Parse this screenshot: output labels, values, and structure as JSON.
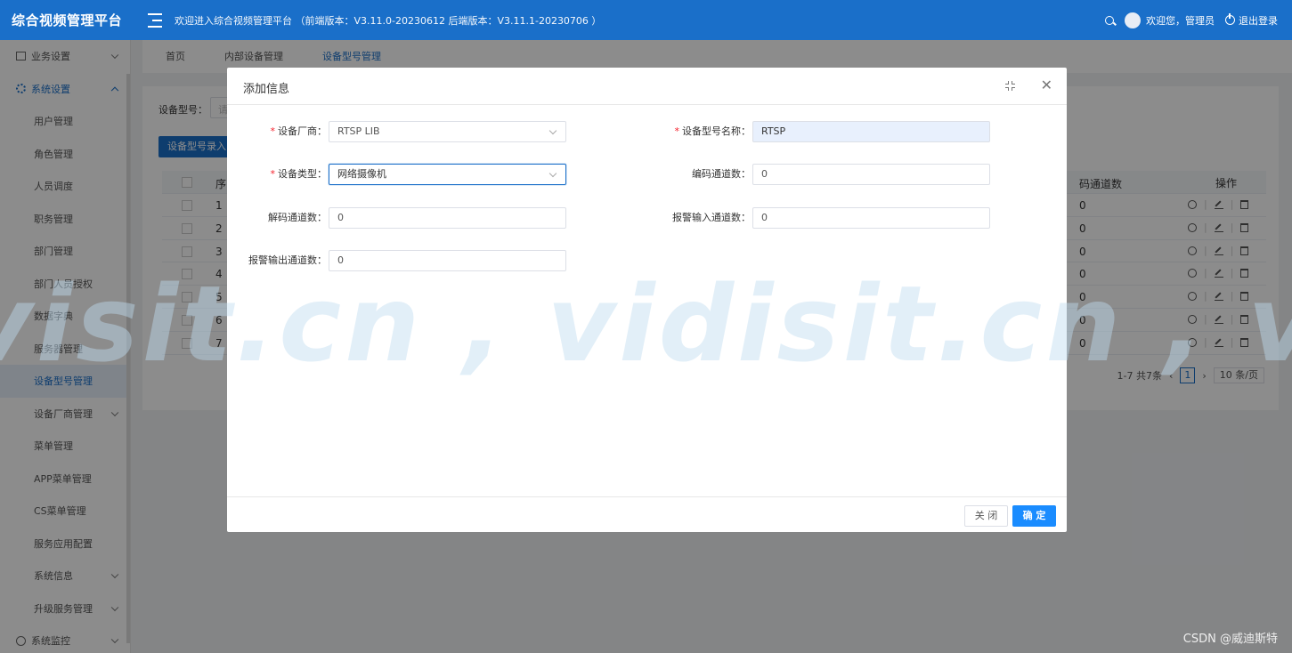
{
  "header": {
    "brand": "综合视频管理平台",
    "welcome": "欢迎进入综合视频管理平台 （前端版本：V3.11.0-20230612 后端版本：V3.11.1-20230706 ）",
    "user_greeting": "欢迎您，管理员",
    "logout": "退出登录"
  },
  "sidebar": {
    "groups": [
      {
        "label": "业务设置",
        "icon": "calendar-icon"
      },
      {
        "label": "系统设置",
        "icon": "gear-icon"
      }
    ],
    "items": [
      "用户管理",
      "角色管理",
      "人员调度",
      "职务管理",
      "部门管理",
      "部门人员授权",
      "数据字典",
      "服务器管理",
      "设备型号管理",
      "设备厂商管理",
      "菜单管理",
      "APP菜单管理",
      "CS菜单管理",
      "服务应用配置",
      "系统信息",
      "升级服务管理"
    ],
    "bottom_group": {
      "label": "系统监控",
      "icon": "clock-icon"
    }
  },
  "tabs": [
    "首页",
    "内部设备管理",
    "设备型号管理"
  ],
  "filter": {
    "label": "设备型号：",
    "placeholder": "请"
  },
  "add_button": "设备型号录入",
  "table": {
    "headers": {
      "seq": "序",
      "decode": "码通道数",
      "ops": "操作"
    },
    "rows": [
      {
        "seq": "1",
        "decode": "0"
      },
      {
        "seq": "2",
        "decode": "0"
      },
      {
        "seq": "3",
        "decode": "0"
      },
      {
        "seq": "4",
        "decode": "0"
      },
      {
        "seq": "5",
        "decode": "0"
      },
      {
        "seq": "6",
        "decode": "0"
      },
      {
        "seq": "7",
        "decode": "0"
      }
    ]
  },
  "pager": {
    "summary": "1-7 共7条",
    "page": "1",
    "size": "10 条/页"
  },
  "watermark": "visit.cn , vidisit.cn , vidisit",
  "modal": {
    "title": "添加信息",
    "fields": {
      "vendor": {
        "label": "设备厂商：",
        "value": "RTSP LIB",
        "required": true
      },
      "model_name": {
        "label": "设备型号名称：",
        "value": "RTSP",
        "required": true
      },
      "device_type": {
        "label": "设备类型：",
        "value": "网络摄像机",
        "required": true
      },
      "encode_channels": {
        "label": "编码通道数：",
        "value": "0"
      },
      "decode_channels": {
        "label": "解码通道数：",
        "value": "0"
      },
      "alarm_in": {
        "label": "报警输入通道数：",
        "value": "0"
      },
      "alarm_out": {
        "label": "报警输出通道数：",
        "value": "0"
      }
    },
    "close_label": "关 闭",
    "ok_label": "确 定"
  },
  "footer_credit": "CSDN @威迪斯特",
  "colors": {
    "primary": "#1a6fc9",
    "ok_button": "#1a8cff",
    "required": "#f5222d"
  }
}
